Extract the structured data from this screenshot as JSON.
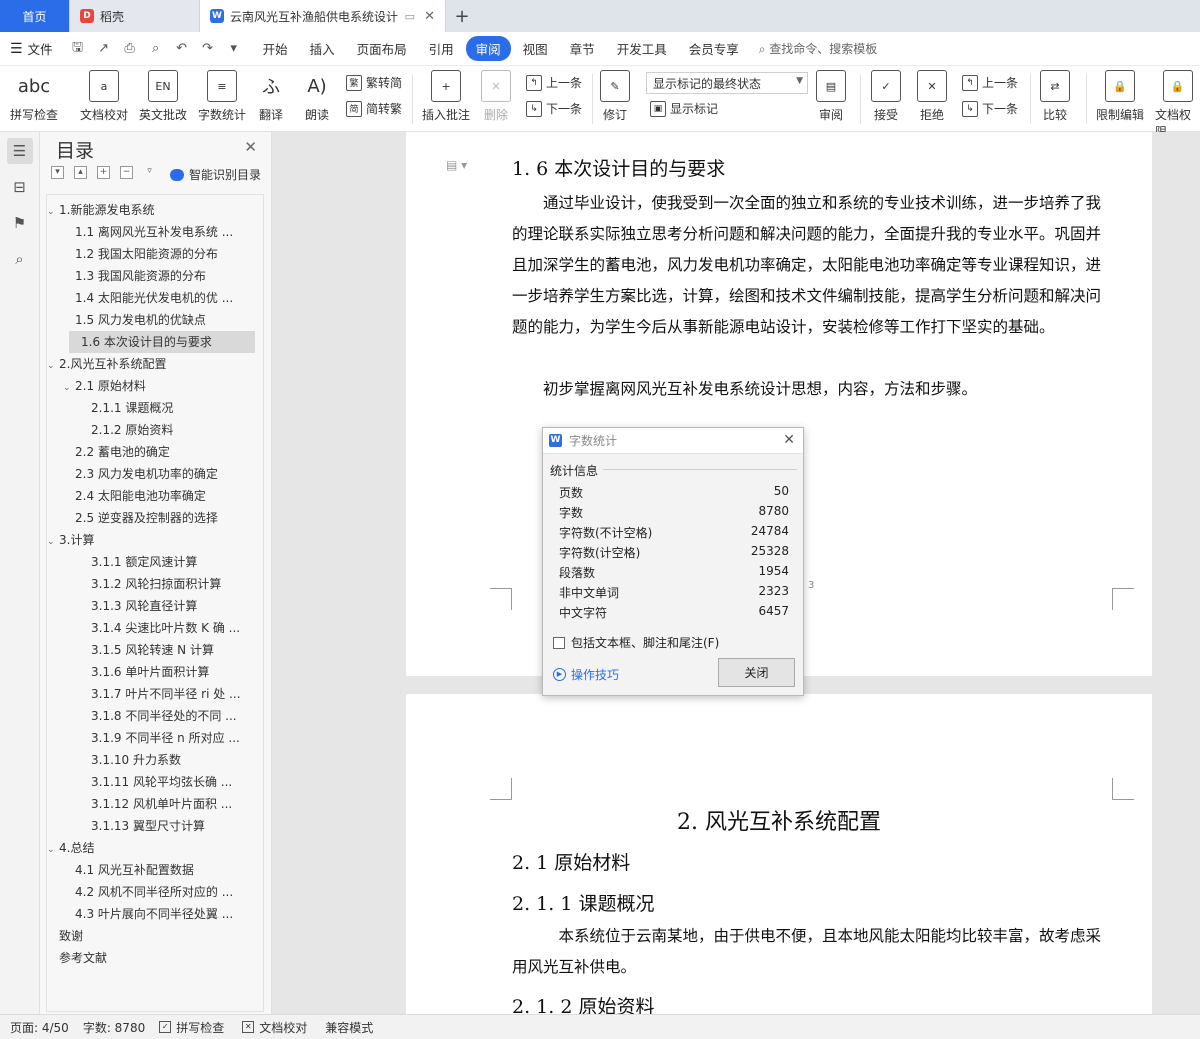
{
  "tabs": {
    "home": "首页",
    "daoke": "稻壳",
    "doc": "云南风光互补渔船供电系统设计",
    "add": "+"
  },
  "menubar": {
    "file": "文件",
    "tabs": [
      "开始",
      "插入",
      "页面布局",
      "引用",
      "审阅",
      "视图",
      "章节",
      "开发工具",
      "会员专享"
    ],
    "active_tab": "审阅",
    "search": "查找命令、搜索模板"
  },
  "ribbon": {
    "spell_check": "拼写检查",
    "doc_proof": "文档校对",
    "en_review": "英文批改",
    "word_count": "字数统计",
    "translate": "翻译",
    "read_aloud": "朗读",
    "trad": "繁转简",
    "simp": "简转繁",
    "insert_comment": "插入批注",
    "delete": "删除",
    "prev": "上一条",
    "next": "下一条",
    "revise": "修订",
    "markup_select": "显示标记的最终状态",
    "show_markup": "显示标记",
    "review": "审阅",
    "accept": "接受",
    "reject": "拒绝",
    "prev2": "上一条",
    "next2": "下一条",
    "compare": "比较",
    "restrict": "限制编辑",
    "doc_perm": "文档权限"
  },
  "toc": {
    "title": "目录",
    "smart": "智能识别目录",
    "items": [
      {
        "label": "1.新能源发电系统",
        "level": 1,
        "tw": "v"
      },
      {
        "label": "1.1 离网风光互补发电系统 ...",
        "level": 2
      },
      {
        "label": "1.2 我国太阳能资源的分布",
        "level": 2
      },
      {
        "label": "1.3 我国风能资源的分布",
        "level": 2
      },
      {
        "label": "1.4 太阳能光伏发电机的优 ...",
        "level": 2
      },
      {
        "label": "1.5 风力发电机的优缺点",
        "level": 2
      },
      {
        "label": "1.6 本次设计目的与要求",
        "level": 2,
        "selected": true
      },
      {
        "label": "2.风光互补系统配置",
        "level": 1,
        "tw": "v"
      },
      {
        "label": "2.1 原始材料",
        "level": 2,
        "tw": "v"
      },
      {
        "label": "2.1.1 课题概况",
        "level": 3
      },
      {
        "label": "2.1.2 原始资料",
        "level": 3
      },
      {
        "label": "2.2  蓄电池的确定",
        "level": 2
      },
      {
        "label": "2.3 风力发电机功率的确定",
        "level": 2
      },
      {
        "label": "2.4 太阳能电池功率确定",
        "level": 2
      },
      {
        "label": "2.5 逆变器及控制器的选择",
        "level": 2
      },
      {
        "label": "3.计算",
        "level": 1,
        "tw": "v"
      },
      {
        "label": "3.1.1 额定风速计算",
        "level": 3
      },
      {
        "label": "3.1.2 风轮扫掠面积计算",
        "level": 3
      },
      {
        "label": "3.1.3 风轮直径计算",
        "level": 3
      },
      {
        "label": "3.1.4 尖速比叶片数 K 确 ...",
        "level": 3
      },
      {
        "label": "3.1.5 风轮转速 N 计算",
        "level": 3
      },
      {
        "label": "3.1.6 单叶片面积计算",
        "level": 3
      },
      {
        "label": "3.1.7 叶片不同半径 ri 处 ...",
        "level": 3
      },
      {
        "label": "3.1.8 不同半径处的不同 ...",
        "level": 3
      },
      {
        "label": "3.1.9 不同半径 n 所对应 ...",
        "level": 3
      },
      {
        "label": "3.1.10 升力系数",
        "level": 3
      },
      {
        "label": "3.1.11 风轮平均弦长确 ...",
        "level": 3
      },
      {
        "label": "3.1.12 风机单叶片面积 ...",
        "level": 3
      },
      {
        "label": "3.1.13 翼型尺寸计算",
        "level": 3
      },
      {
        "label": "4.总结",
        "level": 1,
        "tw": "v"
      },
      {
        "label": "4.1 风光互补配置数据",
        "level": 2
      },
      {
        "label": "4.2 风机不同半径所对应的 ...",
        "level": 2
      },
      {
        "label": "4.3 叶片展向不同半径处翼 ...",
        "level": 2
      },
      {
        "label": "致谢",
        "level": 1
      },
      {
        "label": "参考文献",
        "level": 1
      }
    ]
  },
  "document": {
    "heading_16": "1. 6 本次设计目的与要求",
    "para1": "通过毕业设计，使我受到一次全面的独立和系统的专业技术训练，进一步培养了我的理论联系实际独立思考分析问题和解决问题的能力，全面提升我的专业水平。巩固并且加深学生的蓄电池，风力发电机功率确定，太阳能电池功率确定等专业课程知识，进一步培养学生方案比选，计算，绘图和技术文件编制技能，提高学生分析问题和解决问题的能力，为学生今后从事新能源电站设计，安装检修等工作打下坚实的基础。",
    "para2": "初步掌握离网风光互补发电系统设计思想，内容，方法和步骤。",
    "page_number": "3",
    "chapter2": "2. 风光互补系统配置",
    "h21": "2. 1 原始材料",
    "h211": "2. 1. 1 课题概况",
    "para3": "本系统位于云南某地，由于供电不便，且本地风能太阳能均比较丰富，故考虑采用风光互补供电。",
    "h212": "2. 1. 2 原始资料"
  },
  "dialog": {
    "title": "字数统计",
    "section": "统计信息",
    "rows": [
      {
        "label": "页数",
        "value": "50"
      },
      {
        "label": "字数",
        "value": "8780"
      },
      {
        "label": "字符数(不计空格)",
        "value": "24784"
      },
      {
        "label": "字符数(计空格)",
        "value": "25328"
      },
      {
        "label": "段落数",
        "value": "1954"
      },
      {
        "label": "非中文单词",
        "value": "2323"
      },
      {
        "label": "中文字符",
        "value": "6457"
      }
    ],
    "include_check": "包括文本框、脚注和尾注(F)",
    "tips": "操作技巧",
    "close": "关闭"
  },
  "status": {
    "page": "页面: 4/50",
    "words": "字数: 8780",
    "spell": "拼写检查",
    "proof": "文档校对",
    "compat": "兼容模式"
  },
  "colors": {
    "accent": "#2b6de8",
    "selection": "#d9d9d9"
  }
}
